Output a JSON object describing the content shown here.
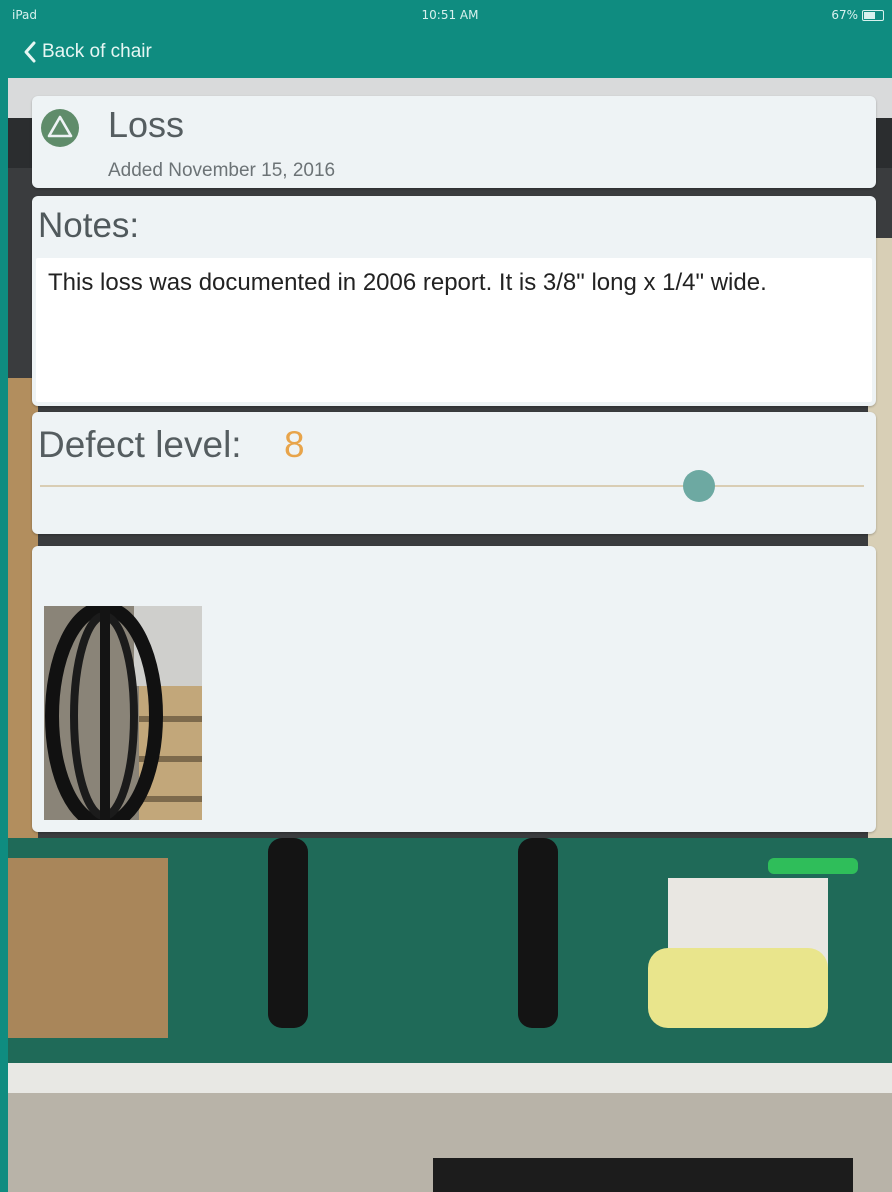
{
  "status_bar": {
    "device": "iPad",
    "time": "10:51 AM",
    "battery": "67%",
    "battery_level": 0.67
  },
  "nav": {
    "back_label": "Back of chair"
  },
  "defect": {
    "icon": "warning-triangle-icon",
    "title": "Loss",
    "added": "Added November 15, 2016"
  },
  "notes": {
    "label": "Notes:",
    "text": "This loss was documented in 2006 report. It is 3/8\" long x 1/4\" wide."
  },
  "defect_level": {
    "label": "Defect level:",
    "value": "8",
    "slider_fraction": 0.8
  },
  "colors": {
    "bar": "#0f8c80",
    "accent": "#e8a44a",
    "thumb": "#6da9a2",
    "icon_circle": "#5f8c6a"
  }
}
